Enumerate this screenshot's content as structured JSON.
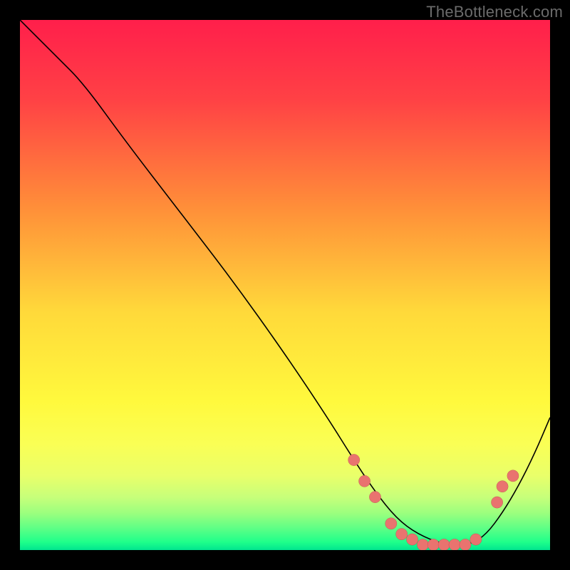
{
  "watermark": "TheBottleneck.com",
  "colors": {
    "frame": "#000000",
    "watermark": "#6b6b6b",
    "curve": "#000000",
    "marker_fill": "#e9736f",
    "marker_stroke": "#9c3a35"
  },
  "chart_data": {
    "type": "line",
    "title": "",
    "xlabel": "",
    "ylabel": "",
    "xlim": [
      0,
      100
    ],
    "ylim": [
      0,
      100
    ],
    "gradient_stops": [
      {
        "pos": 0.0,
        "color": "#ff1f4b"
      },
      {
        "pos": 0.15,
        "color": "#ff4145"
      },
      {
        "pos": 0.35,
        "color": "#ff8d39"
      },
      {
        "pos": 0.55,
        "color": "#ffd93a"
      },
      {
        "pos": 0.72,
        "color": "#fff93d"
      },
      {
        "pos": 0.8,
        "color": "#faff55"
      },
      {
        "pos": 0.86,
        "color": "#e9ff6a"
      },
      {
        "pos": 0.9,
        "color": "#c7ff7a"
      },
      {
        "pos": 0.93,
        "color": "#9cff7e"
      },
      {
        "pos": 0.96,
        "color": "#5bff86"
      },
      {
        "pos": 0.985,
        "color": "#1fff8a"
      },
      {
        "pos": 1.0,
        "color": "#00e58f"
      }
    ],
    "series": [
      {
        "name": "bottleneck-curve",
        "x": [
          0,
          4,
          7,
          12,
          20,
          30,
          40,
          50,
          58,
          63,
          67,
          71,
          75,
          80,
          85,
          88,
          91,
          94,
          97,
          100
        ],
        "y": [
          100,
          96,
          93,
          88,
          77,
          64,
          51,
          37,
          25,
          17,
          11,
          6,
          3,
          1,
          1,
          3,
          7,
          12,
          18,
          25
        ]
      }
    ],
    "markers": [
      {
        "x": 63,
        "y": 17
      },
      {
        "x": 65,
        "y": 13
      },
      {
        "x": 67,
        "y": 10
      },
      {
        "x": 70,
        "y": 5
      },
      {
        "x": 72,
        "y": 3
      },
      {
        "x": 74,
        "y": 2
      },
      {
        "x": 76,
        "y": 1
      },
      {
        "x": 78,
        "y": 1
      },
      {
        "x": 80,
        "y": 1
      },
      {
        "x": 82,
        "y": 1
      },
      {
        "x": 84,
        "y": 1
      },
      {
        "x": 86,
        "y": 2
      },
      {
        "x": 90,
        "y": 9
      },
      {
        "x": 91,
        "y": 12
      },
      {
        "x": 93,
        "y": 14
      }
    ]
  }
}
